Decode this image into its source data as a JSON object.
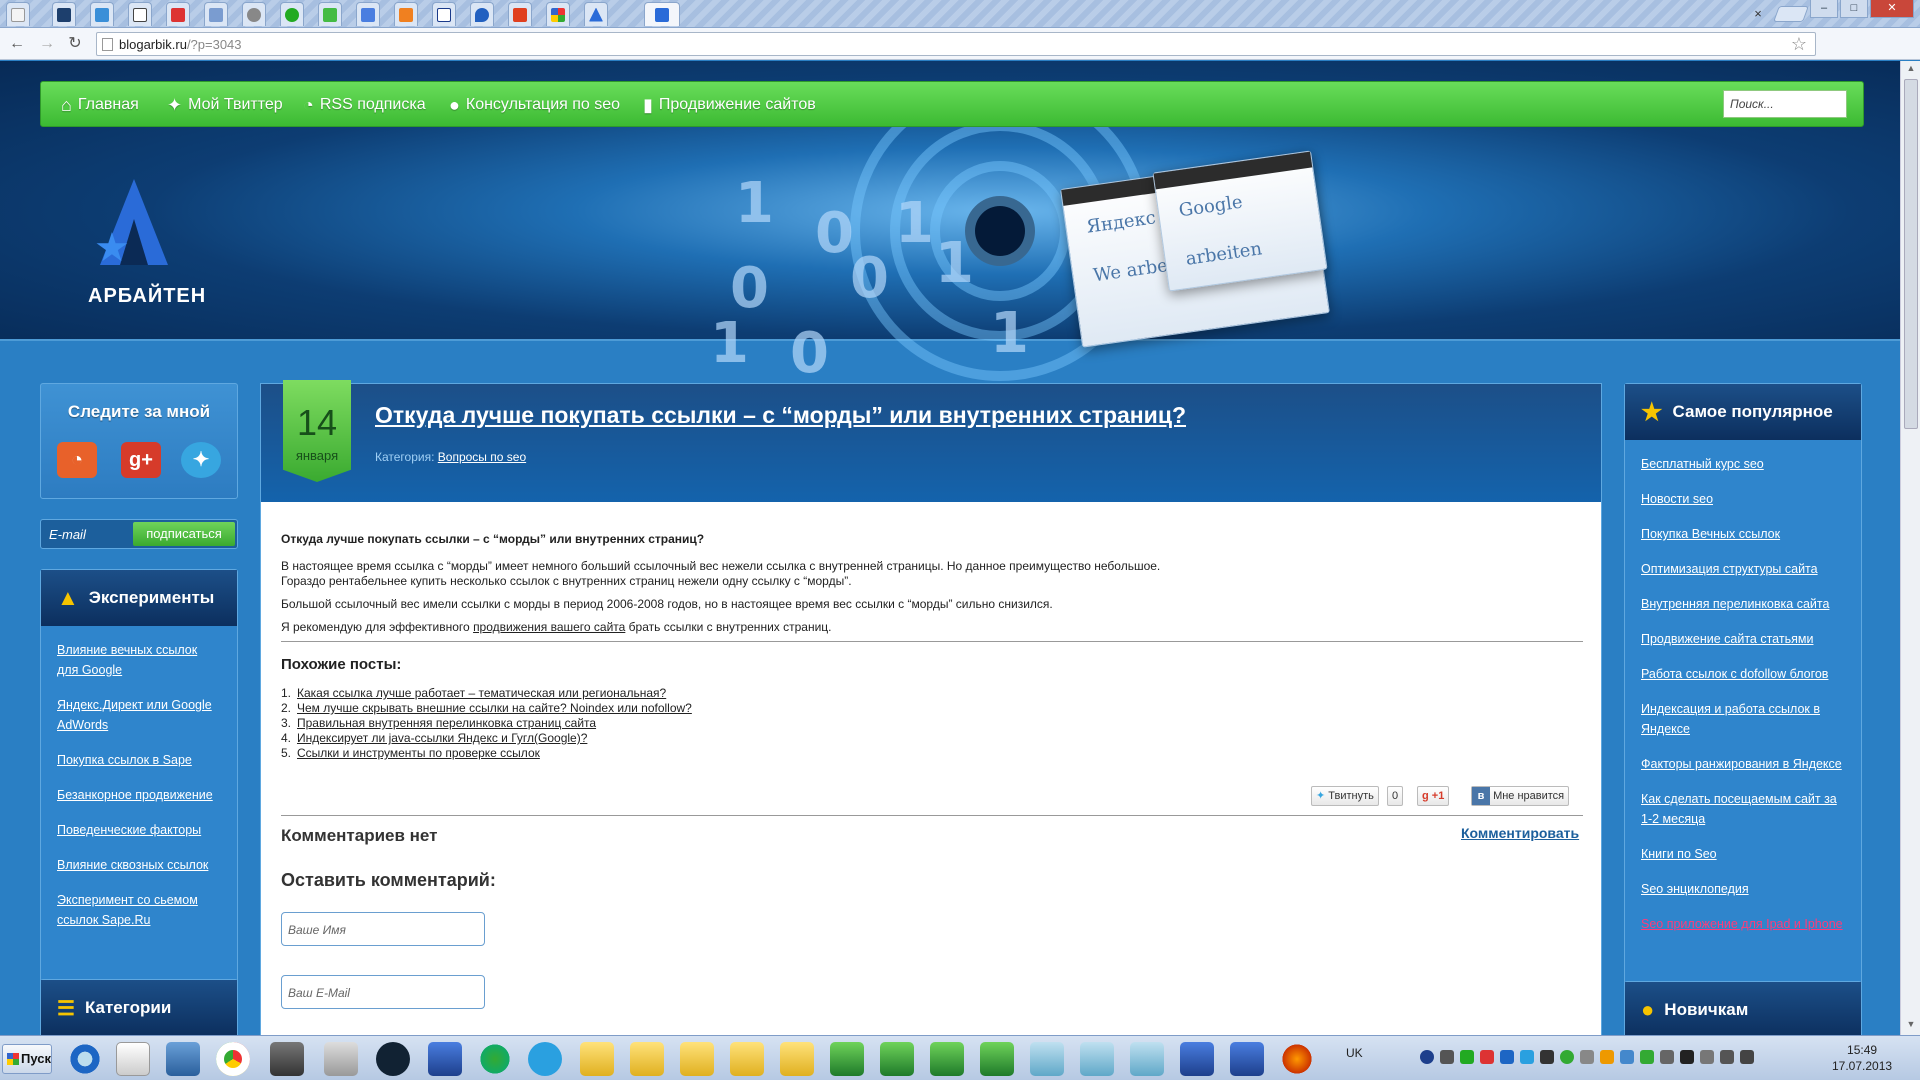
{
  "browser": {
    "url_host": "blogarbik.ru",
    "url_path": "/?p=3043",
    "tab_close": "×",
    "win_min": "–",
    "win_max": "□",
    "win_close": "✕"
  },
  "nav": {
    "items": [
      {
        "label": "Главная",
        "icon": "home-icon",
        "glyph": "⌂"
      },
      {
        "label": "Мой Твиттер",
        "icon": "twitter-icon",
        "glyph": "✦"
      },
      {
        "label": "RSS подписка",
        "icon": "rss-icon",
        "glyph": "◔"
      },
      {
        "label": "Консультация по seo",
        "icon": "speech-bubble-icon",
        "glyph": "●"
      },
      {
        "label": "Продвижение сайтов",
        "icon": "bar-chart-icon",
        "glyph": "▮"
      }
    ],
    "search_placeholder": "Поиск..."
  },
  "logo": {
    "name": "АРБАЙТЕН"
  },
  "header_art": {
    "digits": [
      "1",
      "0",
      "1",
      "0",
      "1",
      "0",
      "1",
      "0",
      "1"
    ],
    "card_text": [
      "Яндекс",
      "Google",
      "arbeiten",
      "We arbeiten"
    ]
  },
  "follow": {
    "title": "Следите за мной",
    "email_placeholder": "E-mail",
    "subscribe_label": "подписаться"
  },
  "experiments": {
    "title": "Эксперименты",
    "items": [
      "Влияние вечных ссылок для Google",
      "Яндекс.Директ или Google AdWords",
      "Покупка ссылок в Sape",
      "Безанкорное продвижение",
      "Поведенческие факторы",
      "Влияние сквозных ссылок",
      "Эксперимент со сьемом ссылок Sape.Ru"
    ]
  },
  "categories": {
    "title": "Категории"
  },
  "post": {
    "day": "14",
    "month": "января",
    "title": "Откуда лучше покупать ссылки – с “морды” или внутренних страниц?",
    "category_label": "Категория:",
    "category_link": "Вопросы по seo",
    "lead": "Откуда лучше покупать ссылки – с “морды” или внутренних страниц?",
    "p1": "В настоящее время ссылка с “морды” имеет немного больший ссылочный вес нежели ссылка с внутренней страницы. Но данное преимущество небольшое.",
    "p1b": "Гораздо рентабельнее купить несколько ссылок с внутренних страниц нежели одну ссылку с “морды”.",
    "p2": "Большой ссылочный вес имели ссылки с морды в период 2006-2008 годов, но в настоящее время вес ссылки с “морды” сильно снизился.",
    "p3_before": "Я рекомендую для эффективного ",
    "p3_link": "продвижения вашего сайта",
    "p3_after": " брать ссылки с внутренних страниц.",
    "similar_title": "Похожие посты:",
    "similar": [
      {
        "n": "1.",
        "t": "Какая ссылка лучше работает – тематическая или региональная?"
      },
      {
        "n": "2.",
        "t": "Чем лучше скрывать внешние ссылки на сайте? Noindex или nofollow?"
      },
      {
        "n": "3.",
        "t": "Правильная внутренняя перелинковка страниц сайта"
      },
      {
        "n": "4.",
        "t": "Индексирует ли java-ссылки Яндекс и Гугл(Google)?"
      },
      {
        "n": "5.",
        "t": "Ссылки и инструменты по проверке ссылок"
      }
    ],
    "tweet_label": "Твитнуть",
    "tweet_count": "0",
    "gplus_label": "+1",
    "vk_label": "Мне нравится",
    "no_comments": "Комментариев нет",
    "comment_link": "Комментировать",
    "leave_comment": "Оставить комментарий:",
    "name_placeholder": "Ваше Имя",
    "email_placeholder": "Ваш E-Mail"
  },
  "popular": {
    "title": "Самое популярное",
    "items": [
      "Бесплатный курс seo",
      "Новости seo",
      "Покупка Вечных ссылок",
      "Оптимизация структуры сайта",
      "Внутренняя перелинковка сайта",
      "Продвижение сайта статьями",
      "Работа ссылок с dofollow блогов",
      "Индексация и работа ссылок в Яндексе",
      "Факторы ранжирования в Яндексе",
      "Как сделать посещаемым сайт за 1-2 месяца",
      "Книги по Seo",
      "Seo энциклопедия",
      "Seo приложение для Ipad и Iphone"
    ]
  },
  "newbies": {
    "title": "Новичкам"
  },
  "taskbar": {
    "start_label": "Пуск",
    "lang": "UK",
    "time": "15:49",
    "date": "17.07.2013"
  },
  "colors": {
    "nav_green": "#3cba33",
    "link_blue": "#1c5f9c",
    "accent_red": "#ff3b7a"
  }
}
